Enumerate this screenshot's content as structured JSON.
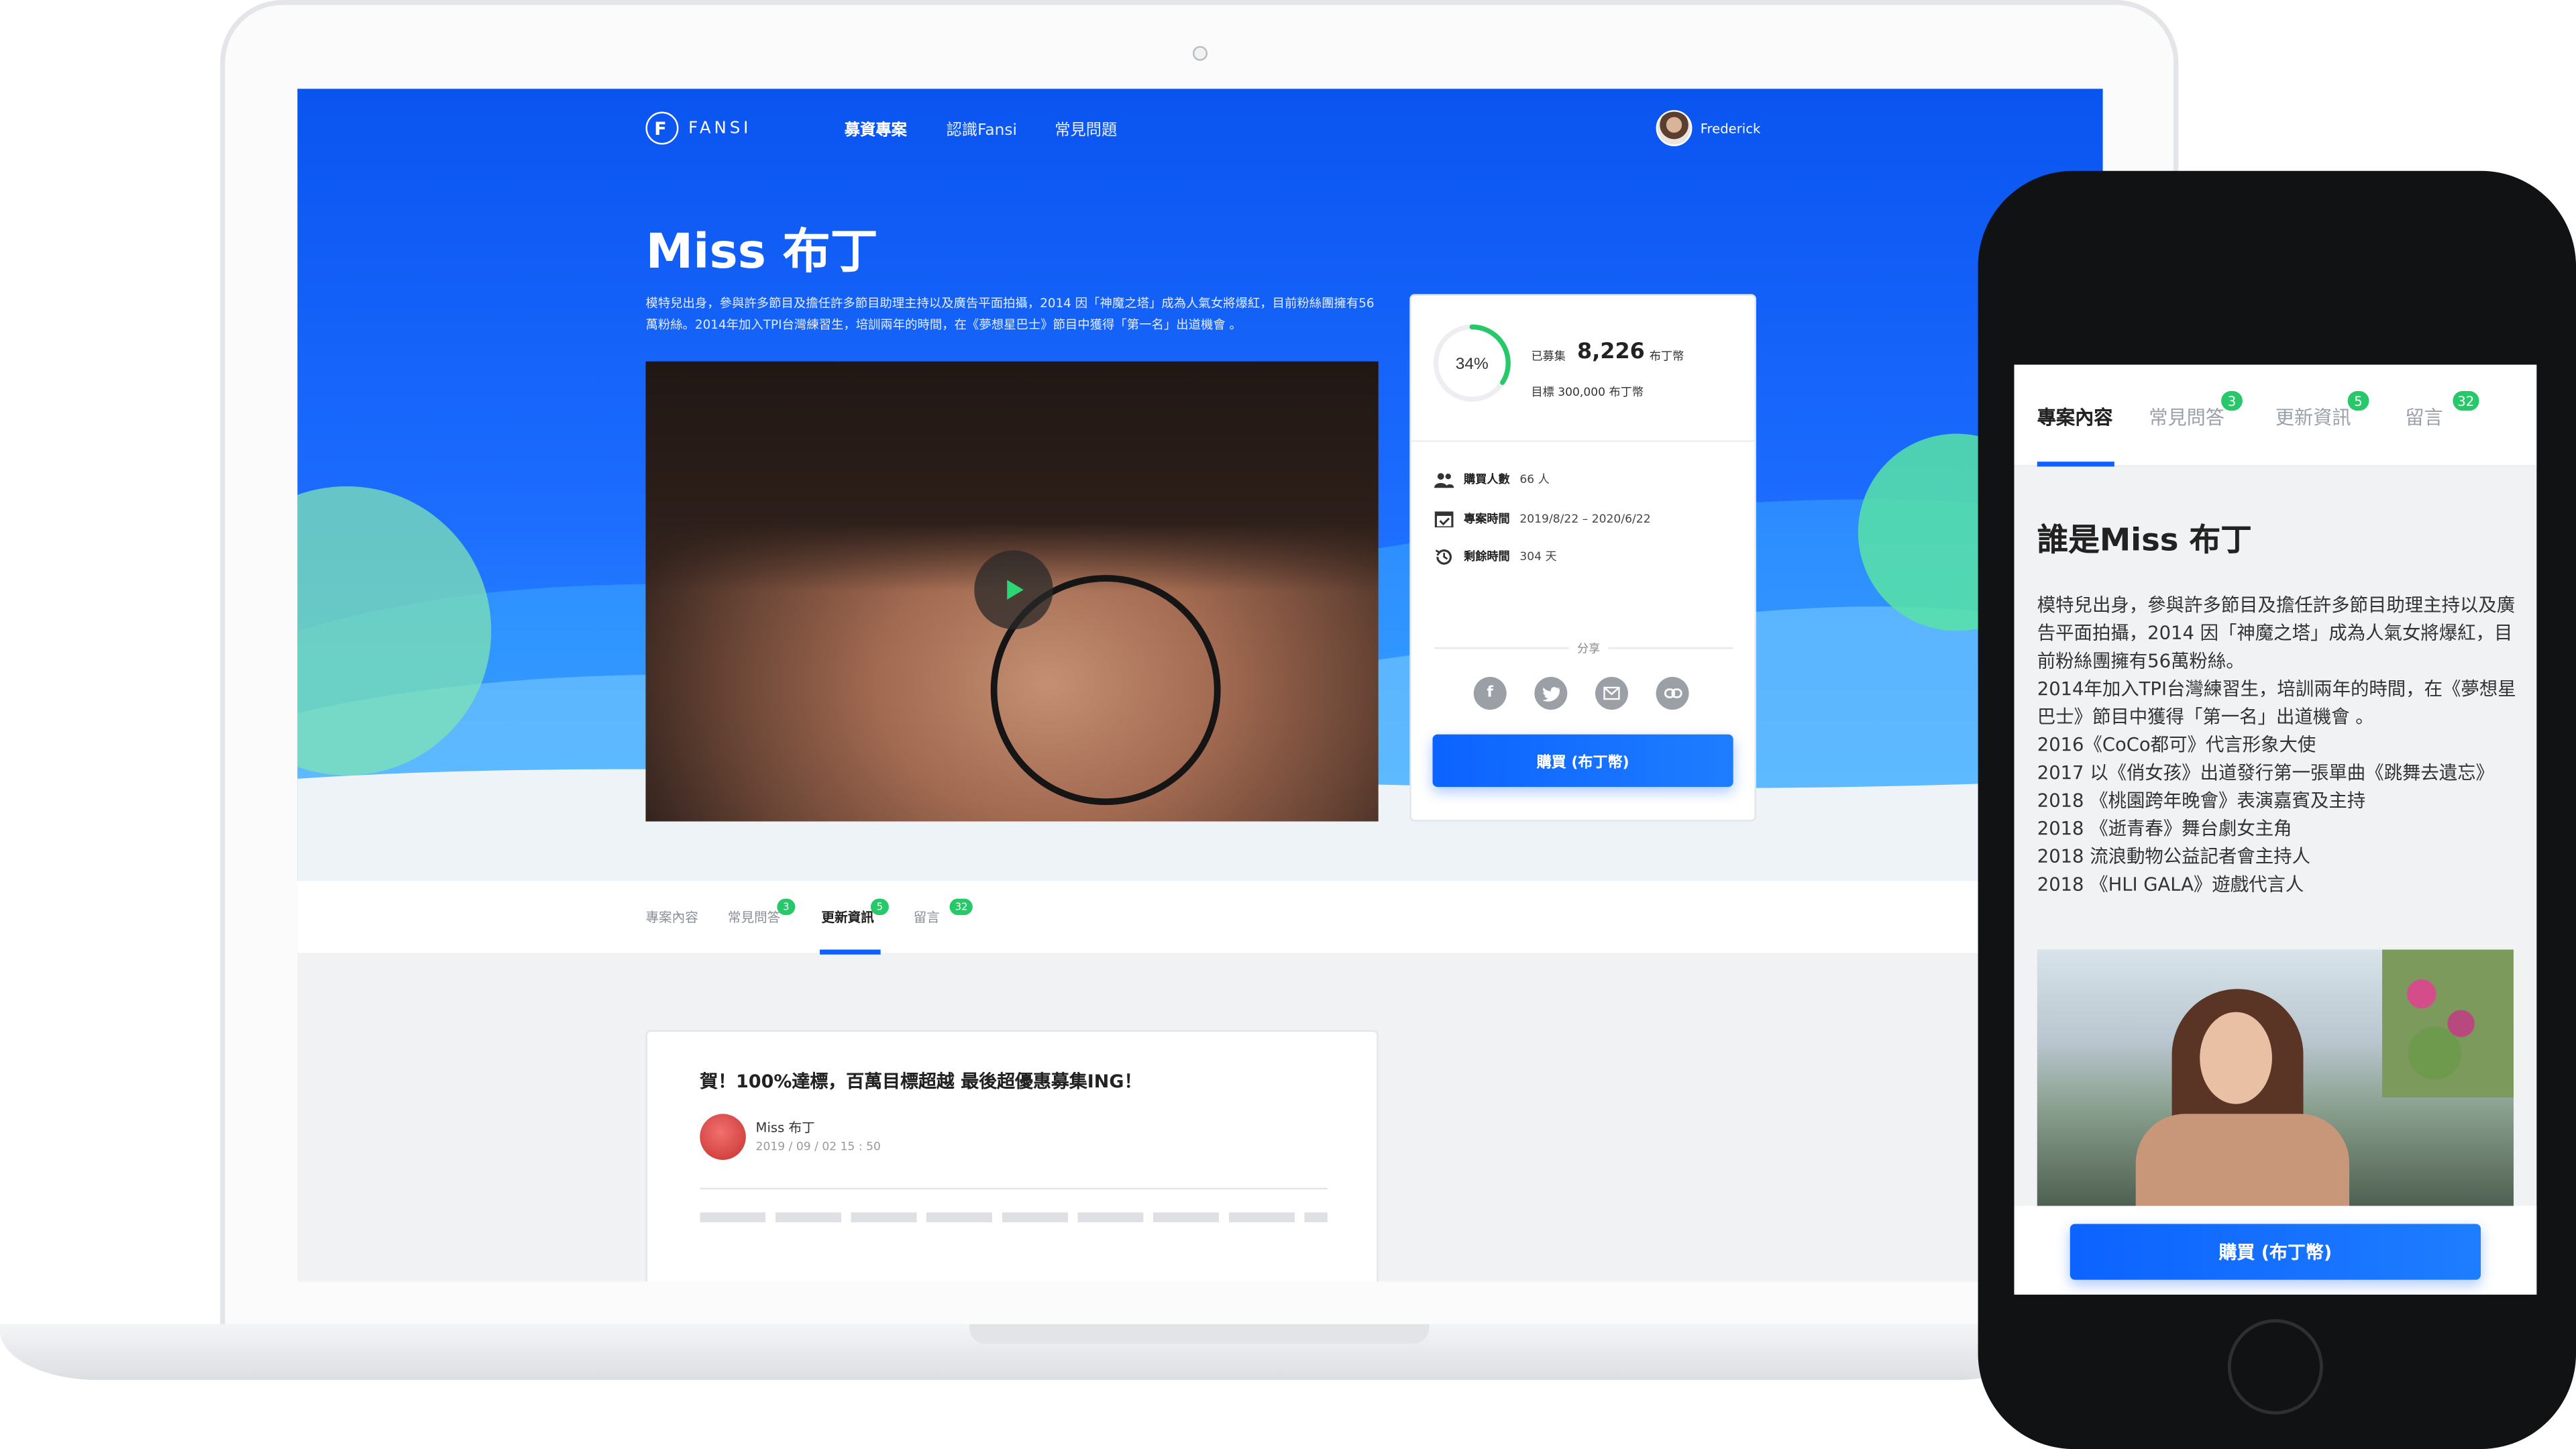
{
  "desktop": {
    "brand": "FANSI",
    "nav": [
      "募資專案",
      "認識Fansi",
      "常見問題"
    ],
    "user_name": "Frederick",
    "project_title": "Miss 布丁",
    "description": "模特兒出身，參與許多節目及擔任許多節目助理主持以及廣告平面拍攝，2014 因「神魔之塔」成為人氣女將爆紅，目前粉絲團擁有56萬粉絲。2014年加入TPI台灣練習生，培訓兩年的時間，在《夢想星巴士》節目中獲得「第一名」出道機會 。",
    "funding": {
      "percent_text": "34%",
      "progress": 0.34,
      "raised_label": "已募集",
      "raised_value": "8,226",
      "raised_unit": "布丁幣",
      "goal_text": "目標  300,000  布丁幣",
      "buyers_label": "購買人數",
      "buyers_value": "66 人",
      "period_label": "專案時間",
      "period_value": "2019/8/22 – 2020/6/22",
      "remain_label": "剩餘時間",
      "remain_value": "304 天",
      "share_label": "分享",
      "buy_label": "購買 (布丁幣)"
    },
    "tabs": [
      {
        "label": "專案內容",
        "badge": ""
      },
      {
        "label": "常見問答",
        "badge": "3"
      },
      {
        "label": "更新資訊",
        "badge": "5"
      },
      {
        "label": "留言",
        "badge": "32"
      }
    ],
    "post": {
      "title": "賀！100%達標，百萬目標超越 最後超優惠募集ING！",
      "author": "Miss 布丁",
      "date": "2019 / 09 / 02 15 : 50"
    }
  },
  "mobile": {
    "tabs": [
      {
        "label": "專案內容",
        "badge": ""
      },
      {
        "label": "常見問答",
        "badge": "3"
      },
      {
        "label": "更新資訊",
        "badge": "5"
      },
      {
        "label": "留言",
        "badge": "32"
      }
    ],
    "heading": "誰是Miss 布丁",
    "bio": [
      "模特兒出身，參與許多節目及擔任許多節目助理主持以及廣告平面拍攝，2014 因「神魔之塔」成為人氣女將爆紅，目前粉絲團擁有56萬粉絲。",
      "2014年加入TPI台灣練習生，培訓兩年的時間，在《夢想星巴士》節目中獲得「第一名」出道機會 。",
      "2016《CoCo都可》代言形象大使",
      "2017 以《俏女孩》出道發行第一張單曲《跳舞去遺忘》",
      "2018 《桃園跨年晚會》表演嘉賓及主持",
      "2018 《逝青春》舞台劇女主角",
      "2018 流浪動物公益記者會主持人",
      "2018 《HLI GALA》遊戲代言人"
    ],
    "buy_label": "購買 (布丁幣)"
  },
  "colors": {
    "accent_blue": "#1060ff",
    "badge_green": "#27c86a",
    "progress_green": "#27c86a"
  }
}
